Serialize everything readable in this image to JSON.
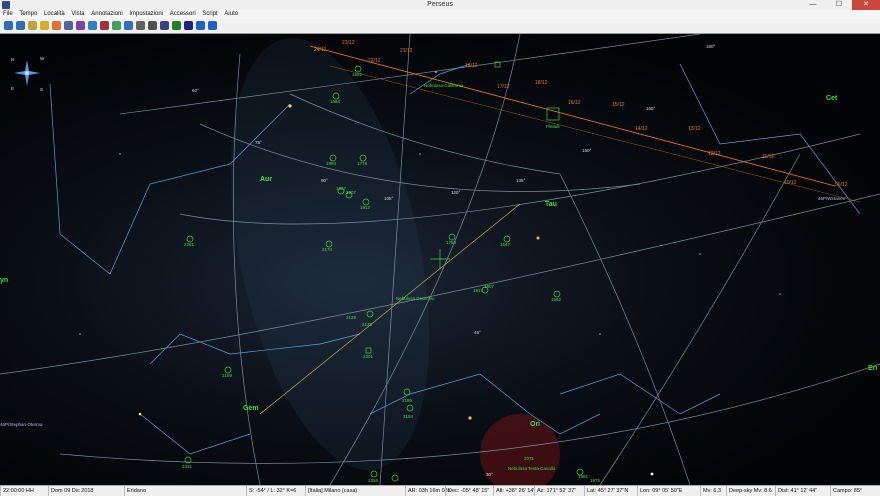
{
  "window": {
    "title": "Perseus",
    "min": "—",
    "max": "☐",
    "close": "✕"
  },
  "menu": [
    "File",
    "Tempo",
    "Località",
    "Vista",
    "Annotazioni",
    "Impostazioni",
    "Accessori",
    "Script",
    "Aiuto"
  ],
  "toolbar_icons": [
    "zoom-in-icon",
    "zoom-out-icon",
    "grid-icon",
    "star-icon",
    "planet-icon",
    "deepsky-icon",
    "comet-icon",
    "constellation-icon",
    "label-icon",
    "horizon-icon",
    "compass-icon",
    "telescope-icon",
    "print-icon",
    "save-icon",
    "play-icon",
    "step-icon",
    "undo-icon",
    "redo-icon"
  ],
  "colors": {
    "grid": "#9fb4c8",
    "constellation": "#5aa0d8",
    "ecliptic": "#e87a22",
    "object": "#39d639",
    "label": "#3fe03f",
    "comet": "#b9b9ff"
  },
  "compass": {
    "N": "N",
    "W": "W",
    "E": "E",
    "S": "S"
  },
  "labels": {
    "cet": "Cet",
    "tau": "Tau",
    "aur": "Aur",
    "ori": "Ori",
    "gem": "Gem",
    "lyn": "yn",
    "eri": "Eri",
    "pleiadi": "Pleiadi",
    "neb_california": "Nebulosa California",
    "neb_granchio": "Nebulosa Granchio",
    "neb_testa": "Nebulosa Testa Cavallo",
    "comet_wirtanen": "46P/Wirtanen",
    "comet_stephan": "46P/Stephan-Oterma"
  },
  "dates": [
    "23/12",
    "22/12",
    "21/12",
    "24/12",
    "20/12",
    "19/12",
    "18/12",
    "17/12",
    "16/12",
    "15/12",
    "14/12",
    "13/12",
    "12/12",
    "11/12",
    "10/12",
    "09/12"
  ],
  "objects": [
    "1582",
    "1664",
    "1893",
    "1778",
    "1857",
    "1907",
    "1912",
    "2281",
    "2420",
    "2129",
    "2174",
    "2175",
    "2301",
    "2186",
    "2169",
    "2194",
    "2331",
    "2264",
    "1981",
    "1975",
    "1750",
    "1647",
    "1817",
    "1807",
    "1662",
    "2071",
    "2355",
    "2392",
    "1952",
    "2024"
  ],
  "grid_labels": [
    "60°",
    "75°",
    "90°",
    "105°",
    "120°",
    "135°",
    "150°",
    "165°",
    "180°",
    "45°",
    "30°",
    "165°"
  ],
  "status": {
    "time": "22:00:00 HH",
    "date": "Dom 09 Dic 2018",
    "const": "Eridano",
    "coords": "S: -54° / L: 32° K=6",
    "site": "[Italia] Milano (casa)",
    "ar": "AR: 03h 16m 08s",
    "dec": "Dec: -05° 48' 15\"",
    "alt": "Alt: +38° 26' 14\"",
    "az": "Az: 171° 52' 37\"",
    "lat": "Lat: 45° 27' 37\"N",
    "lon": "Lon: 09° 05' 50\"E",
    "mv": "Mv: 6.3",
    "deepsky": "Deep-sky Mv: 8.6",
    "dist": "Dist: 41° 12' 44\"",
    "campo": "Campo: 85°"
  }
}
